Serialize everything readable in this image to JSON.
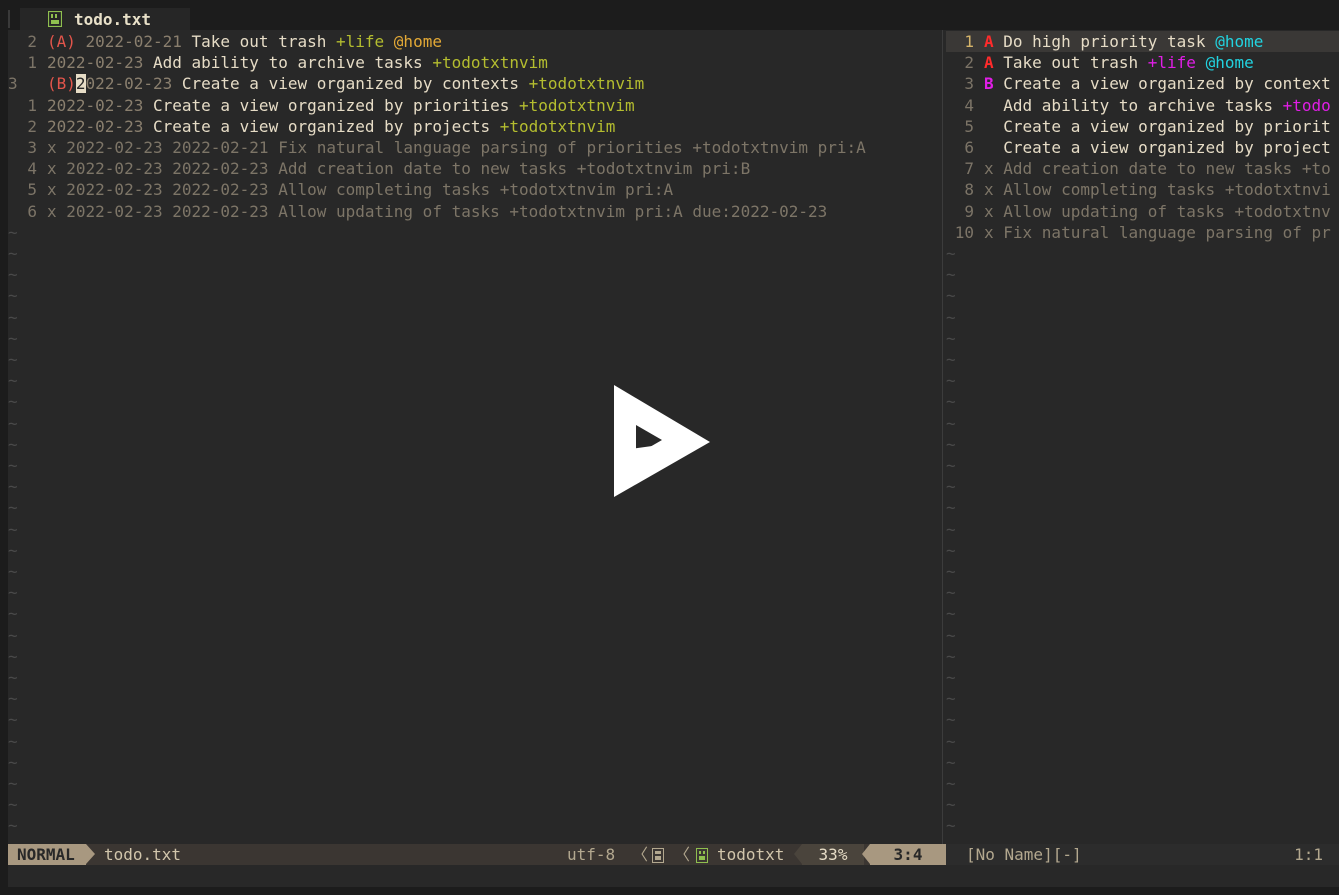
{
  "tab": {
    "title": "todo.txt",
    "icon": "file-icon"
  },
  "left_lines": [
    {
      "num": "2",
      "parts": [
        [
          "(A) ",
          "c-pri"
        ],
        [
          "2022-02-21 ",
          "c-date"
        ],
        [
          "Take out trash ",
          "c-text"
        ],
        [
          "+life ",
          "c-proj-y"
        ],
        [
          "@home",
          "c-ctx-y"
        ]
      ]
    },
    {
      "num": "1",
      "parts": [
        [
          "2022-02-23 ",
          "c-date"
        ],
        [
          "Add ability to archive tasks ",
          "c-text"
        ],
        [
          "+todotxtnvim",
          "c-proj-y"
        ]
      ]
    },
    {
      "num": "3",
      "current": true,
      "parts": [
        [
          "(B)",
          "c-pri"
        ],
        [
          "2",
          "cursor"
        ],
        [
          "022-02-23 ",
          "c-date"
        ],
        [
          "Create a view organized by contexts ",
          "c-text"
        ],
        [
          "+todotxtnvim",
          "c-proj-y"
        ]
      ]
    },
    {
      "num": "1",
      "parts": [
        [
          "2022-02-23 ",
          "c-date"
        ],
        [
          "Create a view organized by priorities ",
          "c-text"
        ],
        [
          "+todotxtnvim",
          "c-proj-y"
        ]
      ]
    },
    {
      "num": "2",
      "parts": [
        [
          "2022-02-23 ",
          "c-date"
        ],
        [
          "Create a view organized by projects ",
          "c-text"
        ],
        [
          "+todotxtnvim",
          "c-proj-y"
        ]
      ]
    },
    {
      "num": "3",
      "parts": [
        [
          "x 2022-02-23 2022-02-21 Fix natural language parsing of priorities +todotxtnvim pri:A",
          "c-done"
        ]
      ]
    },
    {
      "num": "4",
      "parts": [
        [
          "x 2022-02-23 2022-02-23 Add creation date to new tasks +todotxtnvim pri:B",
          "c-done"
        ]
      ]
    },
    {
      "num": "5",
      "parts": [
        [
          "x 2022-02-23 2022-02-23 Allow completing tasks +todotxtnvim pri:A",
          "c-done"
        ]
      ]
    },
    {
      "num": "6",
      "parts": [
        [
          "x 2022-02-23 2022-02-23 Allow updating of tasks +todotxtnvim pri:A due:2022-02-23",
          "c-done"
        ]
      ]
    }
  ],
  "right_lines": [
    {
      "num": "1",
      "current": true,
      "parts": [
        [
          "A ",
          "c-red"
        ],
        [
          "Do high priority task ",
          "c-text"
        ],
        [
          "@home",
          "c-ctx-c"
        ]
      ]
    },
    {
      "num": "2",
      "parts": [
        [
          "A ",
          "c-red"
        ],
        [
          "Take out trash ",
          "c-text"
        ],
        [
          "+life ",
          "c-proj-m"
        ],
        [
          "@home",
          "c-ctx-c"
        ]
      ]
    },
    {
      "num": "3",
      "parts": [
        [
          "B ",
          "c-mag"
        ],
        [
          "Create a view organized by context",
          "c-text"
        ]
      ]
    },
    {
      "num": "4",
      "parts": [
        [
          "  Add ability to archive tasks ",
          "c-text"
        ],
        [
          "+todo",
          "c-proj-m"
        ]
      ]
    },
    {
      "num": "5",
      "parts": [
        [
          "  Create a view organized by priorit",
          "c-text"
        ]
      ]
    },
    {
      "num": "6",
      "parts": [
        [
          "  Create a view organized by project",
          "c-text"
        ]
      ]
    },
    {
      "num": "7",
      "parts": [
        [
          "x Add creation date to new tasks +to",
          "c-done"
        ]
      ]
    },
    {
      "num": "8",
      "parts": [
        [
          "x Allow completing tasks +todotxtnvi",
          "c-done"
        ]
      ]
    },
    {
      "num": "9",
      "parts": [
        [
          "x Allow updating of tasks +todotxtnv",
          "c-done"
        ]
      ]
    },
    {
      "num": "10",
      "parts": [
        [
          "x Fix natural language parsing of pr",
          "c-done"
        ]
      ]
    }
  ],
  "tilde": "~",
  "tilde_rows": 29,
  "status": {
    "mode": "NORMAL",
    "file": "todo.txt",
    "encoding": "utf-8",
    "filetype": "todotxt",
    "percent": "33%",
    "position": "3:4",
    "right_name": "[No Name][-]",
    "right_position": "1:1"
  },
  "colors": {
    "background": "#282828",
    "priority_a": "#e2554b",
    "project": "#b4bd2f",
    "context": "#e3a936",
    "mode_bg": "#a89880"
  }
}
